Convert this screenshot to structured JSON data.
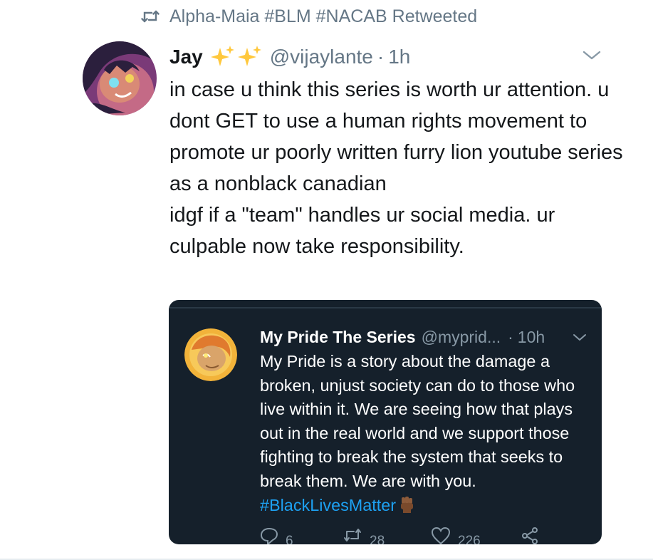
{
  "retweet": {
    "label": "Alpha-Maia #BLM #NACAB Retweeted",
    "icon": "retweet-icon"
  },
  "tweet": {
    "author_name": "Jay",
    "name_emoji": "sparkles-icon",
    "handle": "@vijaylante",
    "separator": "·",
    "time": "1h",
    "text_lines": [
      "in case u think this series is worth ur attention. u dont GET to use a human rights movement to promote ur poorly written furry lion youtube series as a nonblack canadian",
      "idgf if a \"team\" handles ur social media. ur culpable now take responsibility."
    ]
  },
  "quote": {
    "author_name": "My Pride The Series",
    "handle": "@myprid...",
    "separator": "·",
    "time": "10h",
    "text": "My Pride is a story about the damage a broken, unjust society can do to those who live within it. We are seeing how that plays out in the real world and we support those fighting to break the system that seeks to break them. We are with you. ",
    "hashtag": "#BlackLivesMatter",
    "hashtag_emoji": "raised-fist-icon",
    "actions": {
      "replies": "6",
      "retweets": "28",
      "likes": "226"
    }
  },
  "colors": {
    "text": "#14171a",
    "muted": "#657786",
    "card_bg": "#15202b",
    "link": "#1da1f2"
  }
}
